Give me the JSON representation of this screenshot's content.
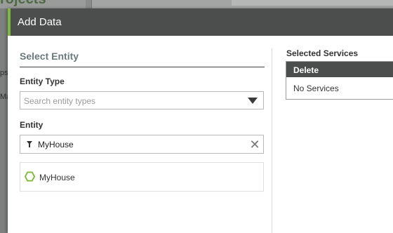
{
  "background": {
    "title": "rojects",
    "left_fragment_1": "ps",
    "left_fragment_2": "Ma"
  },
  "dialog": {
    "title": "Add Data",
    "accent_color": "#7dba3a",
    "select_entity": {
      "heading": "Select Entity",
      "entity_type_label": "Entity Type",
      "entity_type_placeholder": "Search entity types",
      "entity_label": "Entity",
      "entity_filter_value": "MyHouse",
      "results": [
        {
          "name": "MyHouse",
          "icon": "hexagon-icon"
        }
      ]
    },
    "selected_services": {
      "heading": "Selected Services",
      "column_header": "Delete",
      "empty_text": "No Services"
    }
  }
}
